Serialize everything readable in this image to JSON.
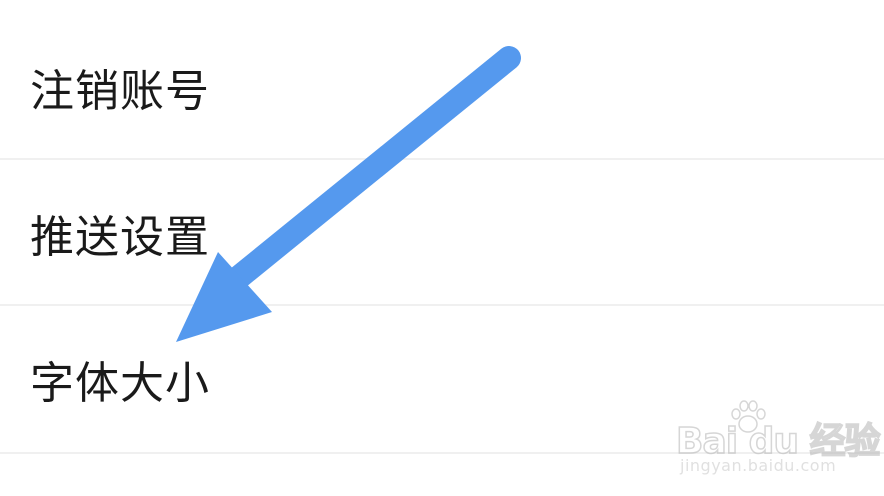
{
  "settings": {
    "items": [
      {
        "label": "注销账号"
      },
      {
        "label": "推送设置"
      },
      {
        "label": "字体大小"
      }
    ]
  },
  "annotation": {
    "icon": "arrow-icon",
    "color": "#5599ee",
    "points_to": "字体大小"
  },
  "watermark": {
    "brand": "Bai du 经验",
    "url": "jingyan.baidu.com",
    "icon": "paw-icon"
  },
  "colors": {
    "background": "#ffffff",
    "text": "#1a1a1a",
    "divider": "#f0f0f0",
    "arrow": "#5599ee"
  }
}
